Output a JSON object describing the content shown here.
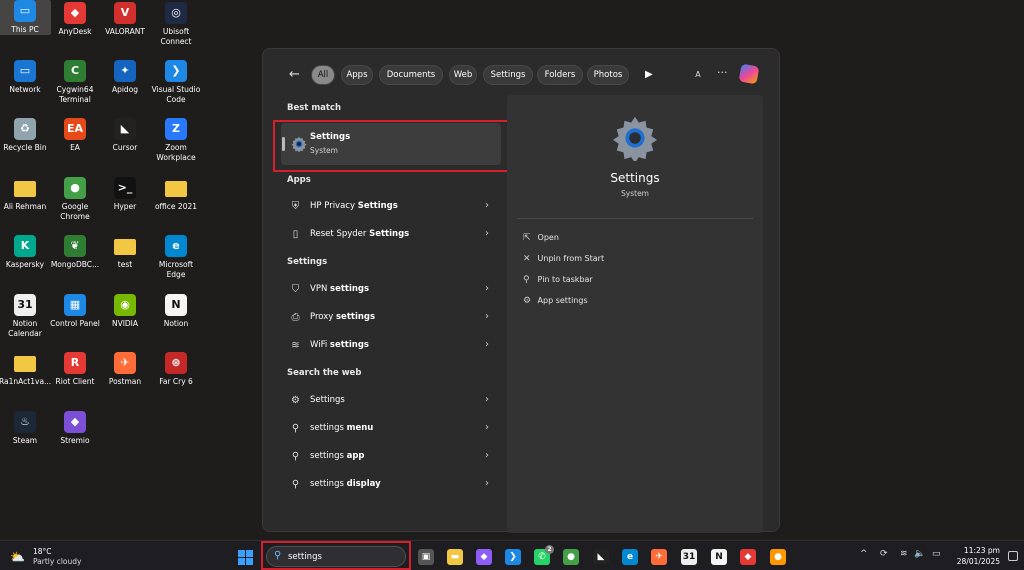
{
  "desktop": {
    "icons": [
      {
        "label": "This PC",
        "color": "#1e88e5",
        "glyph": "▭"
      },
      {
        "label": "AnyDesk",
        "color": "#e53935",
        "glyph": "◆"
      },
      {
        "label": "VALORANT",
        "color": "#d32f2f",
        "glyph": "V"
      },
      {
        "label": "Ubisoft Connect",
        "color": "#1f2a44",
        "glyph": "◎"
      },
      {
        "label": "Network",
        "color": "#1976d2",
        "glyph": "▭"
      },
      {
        "label": "Cygwin64 Terminal",
        "color": "#2e7d32",
        "glyph": "C"
      },
      {
        "label": "Apidog",
        "color": "#1565c0",
        "glyph": "✦"
      },
      {
        "label": "Visual Studio Code",
        "color": "#1e88e5",
        "glyph": "❯"
      },
      {
        "label": "Recycle Bin",
        "color": "#90a4ae",
        "glyph": "♻"
      },
      {
        "label": "EA",
        "color": "#e64a19",
        "glyph": "EA"
      },
      {
        "label": "Cursor",
        "color": "#222222",
        "glyph": "◣"
      },
      {
        "label": "Zoom Workplace",
        "color": "#2979ff",
        "glyph": "Z"
      },
      {
        "label": "Ali Rehman",
        "color": "#f2c744",
        "glyph": ""
      },
      {
        "label": "Google Chrome",
        "color": "#43a047",
        "glyph": "●"
      },
      {
        "label": "Hyper",
        "color": "#111111",
        "glyph": ">_"
      },
      {
        "label": "office 2021",
        "color": "#f2c744",
        "glyph": ""
      },
      {
        "label": "Kaspersky",
        "color": "#00a88e",
        "glyph": "K"
      },
      {
        "label": "MongoDBC...",
        "color": "#2e7d32",
        "glyph": "❦"
      },
      {
        "label": "test",
        "color": "#f2c744",
        "glyph": ""
      },
      {
        "label": "Microsoft Edge",
        "color": "#0288d1",
        "glyph": "e"
      },
      {
        "label": "Notion Calendar",
        "color": "#eeeeee",
        "glyph": "31"
      },
      {
        "label": "Control Panel",
        "color": "#1e88e5",
        "glyph": "▦"
      },
      {
        "label": "NVIDIA",
        "color": "#76b900",
        "glyph": "◉"
      },
      {
        "label": "Notion",
        "color": "#f5f5f5",
        "glyph": "N"
      },
      {
        "label": "Ra1nAct1va...",
        "color": "#f2c744",
        "glyph": ""
      },
      {
        "label": "Riot Client",
        "color": "#e53935",
        "glyph": "R"
      },
      {
        "label": "Postman",
        "color": "#ff6c37",
        "glyph": "✈"
      },
      {
        "label": "Far Cry 6",
        "color": "#c62828",
        "glyph": "⊛"
      },
      {
        "label": "Steam",
        "color": "#1b2838",
        "glyph": "♨"
      },
      {
        "label": "Stremio",
        "color": "#7b4fd6",
        "glyph": "◆"
      }
    ]
  },
  "search_panel": {
    "back_label": "←",
    "filters": [
      "All",
      "Apps",
      "Documents",
      "Web",
      "Settings",
      "Folders",
      "Photos"
    ],
    "more_label": "▶",
    "avatar_letter": "A",
    "more_options": "···",
    "best_match_heading": "Best match",
    "best_match": {
      "title": "Settings",
      "subtitle": "System"
    },
    "apps_heading": "Apps",
    "apps": [
      {
        "prefix": "HP Privacy ",
        "bold": "Settings",
        "icon": "⛨"
      },
      {
        "prefix": "Reset Spyder ",
        "bold": "Settings",
        "icon": "▯"
      }
    ],
    "settings_heading": "Settings",
    "settings": [
      {
        "prefix": "VPN ",
        "bold": "settings",
        "icon": "⛉"
      },
      {
        "prefix": "Proxy ",
        "bold": "settings",
        "icon": "⎙"
      },
      {
        "prefix": "WiFi ",
        "bold": "settings",
        "icon": "≋"
      }
    ],
    "web_heading": "Search the web",
    "web": [
      {
        "prefix": "Settings",
        "bold": "",
        "icon": "⚙"
      },
      {
        "prefix": "settings ",
        "bold": "menu",
        "icon": "⚲"
      },
      {
        "prefix": "settings ",
        "bold": "app",
        "icon": "⚲"
      },
      {
        "prefix": "settings ",
        "bold": "display",
        "icon": "⚲"
      }
    ],
    "chevron": "›",
    "preview": {
      "title": "Settings",
      "subtitle": "System",
      "actions": [
        {
          "label": "Open",
          "icon": "⇱"
        },
        {
          "label": "Unpin from Start",
          "icon": "✕"
        },
        {
          "label": "Pin to taskbar",
          "icon": "⚲"
        },
        {
          "label": "App settings",
          "icon": "⚙"
        }
      ]
    }
  },
  "taskbar": {
    "weather_temp": "18°C",
    "weather_desc": "Partly cloudy",
    "search_value": "settings",
    "search_icon": "search-icon",
    "whatsapp_badge": "2",
    "apps": [
      {
        "name": "task-view",
        "color": "#555555",
        "glyph": "▣"
      },
      {
        "name": "file-explorer",
        "color": "#f2c744",
        "glyph": "▬"
      },
      {
        "name": "copilot",
        "color": "#8e5cf7",
        "glyph": "◆"
      },
      {
        "name": "vscode",
        "color": "#1e88e5",
        "glyph": "❯"
      },
      {
        "name": "whatsapp",
        "color": "#25d366",
        "glyph": "✆"
      },
      {
        "name": "chrome",
        "color": "#43a047",
        "glyph": "●"
      },
      {
        "name": "cursor",
        "color": "#222222",
        "glyph": "◣"
      },
      {
        "name": "edge",
        "color": "#0288d1",
        "glyph": "e"
      },
      {
        "name": "postman",
        "color": "#ff6c37",
        "glyph": "✈"
      },
      {
        "name": "notion-calendar",
        "color": "#eeeeee",
        "glyph": "31"
      },
      {
        "name": "notion",
        "color": "#f5f5f5",
        "glyph": "N"
      },
      {
        "name": "anydesk",
        "color": "#e53935",
        "glyph": "◆"
      },
      {
        "name": "chrome-canary",
        "color": "#ff9800",
        "glyph": "●"
      }
    ],
    "tray": {
      "chevron": "^",
      "sync": "⟳",
      "wifi": "≋",
      "volume": "🔈",
      "battery": "▭"
    },
    "time": "11:23 pm",
    "date": "28/01/2025"
  }
}
